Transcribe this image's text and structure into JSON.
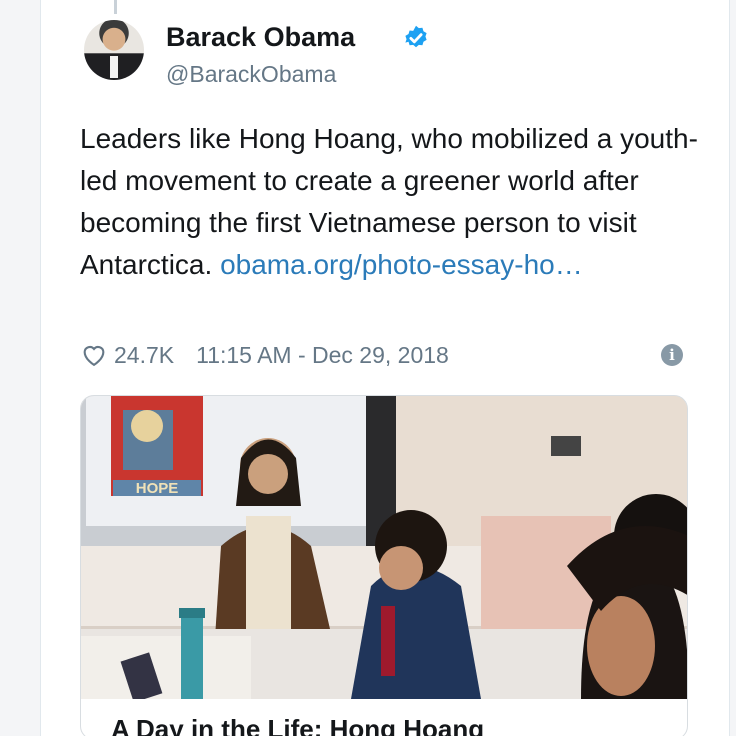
{
  "author": {
    "name": "Barack Obama",
    "handle": "@BarackObama",
    "verified": true
  },
  "tweet": {
    "text": "Leaders like Hong Hoang, who mobilized a youth-led movement to create a greener world after becoming the first Vietnamese person to visit Antarctica. ",
    "link_text": "obama.org/photo-essay-ho…"
  },
  "meta": {
    "likes": "24.7K",
    "timestamp": "11:15 AM - Dec 29, 2018"
  },
  "card": {
    "poster_text": "HOPE",
    "title": "A Day in the Life: Hong Hoang"
  },
  "colors": {
    "link": "#2b7bb9",
    "verified": "#1da1f2",
    "secondary_text": "#657786"
  },
  "icons": [
    "verified-badge-icon",
    "heart-icon",
    "info-icon"
  ]
}
